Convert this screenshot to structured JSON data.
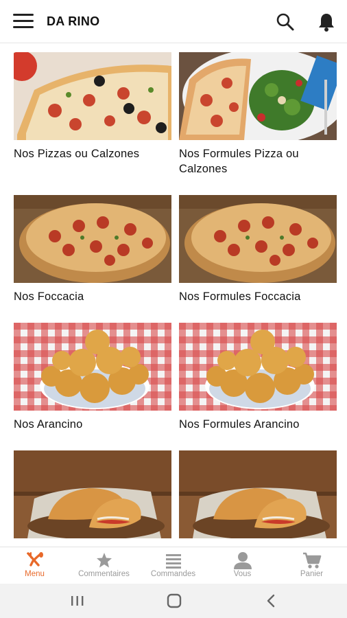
{
  "header": {
    "title": "DA RINO"
  },
  "icons": {
    "menu": "hamburger-icon",
    "search": "search-icon",
    "notifications": "bell-icon"
  },
  "cards": [
    {
      "label": "Nos Pizzas ou Calzones",
      "image": "pizza-photo"
    },
    {
      "label": "Nos Formules Pizza ou Calzones",
      "image": "pizza-salad-photo"
    },
    {
      "label": "Nos Foccacia",
      "image": "focaccia-photo"
    },
    {
      "label": "Nos Formules Foccacia",
      "image": "focaccia-photo"
    },
    {
      "label": "Nos Arancino",
      "image": "arancini-photo"
    },
    {
      "label": "Nos Formules Arancino",
      "image": "arancini-photo"
    },
    {
      "label": "",
      "image": "calzone-photo"
    },
    {
      "label": "",
      "image": "calzone-photo"
    }
  ],
  "bottom_nav": [
    {
      "label": "Menu",
      "icon": "fork-knife-icon",
      "active": true
    },
    {
      "label": "Commentaires",
      "icon": "star-icon",
      "active": false
    },
    {
      "label": "Commandes",
      "icon": "list-icon",
      "active": false
    },
    {
      "label": "Vous",
      "icon": "person-icon",
      "active": false
    },
    {
      "label": "Panier",
      "icon": "cart-icon",
      "active": false
    }
  ],
  "colors": {
    "accent": "#e8692a",
    "inactive": "#9a9a9a",
    "text": "#111111"
  },
  "system_nav": [
    "recents-button",
    "home-button",
    "back-button"
  ]
}
